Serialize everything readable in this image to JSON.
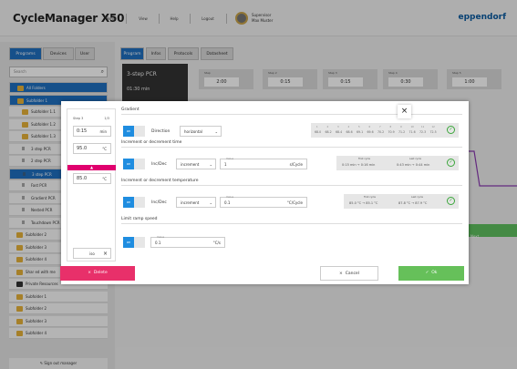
{
  "header": {
    "title": "CycleManager X50",
    "menu_items": [
      "Menu",
      "View",
      "Help",
      "Logout"
    ],
    "user_name": "Max Muster",
    "user_role": "Supervisor",
    "brand": "eppendorf"
  },
  "left": {
    "tabs": [
      "Programs",
      "Devices",
      "User"
    ],
    "search_placeholder": "Search",
    "tree": [
      {
        "label": "All Folders",
        "kind": "folder",
        "selected": true
      },
      {
        "label": "Subfolder 1",
        "kind": "folder",
        "selected": true
      },
      {
        "label": "Subfolder 1.1",
        "kind": "folder"
      },
      {
        "label": "Subfolder 1.2",
        "kind": "folder"
      },
      {
        "label": "Subfolder 1.3",
        "kind": "folder"
      },
      {
        "label": "3 step PCR",
        "kind": "program"
      },
      {
        "label": "2 step PCR",
        "kind": "program"
      },
      {
        "label": "3 step PCR",
        "kind": "program",
        "selected": true
      },
      {
        "label": "Fast PCR",
        "kind": "program"
      },
      {
        "label": "Gradient PCR",
        "kind": "program"
      },
      {
        "label": "Nested PCR",
        "kind": "program"
      },
      {
        "label": "Touchdown PCR",
        "kind": "program"
      },
      {
        "label": "Subfolder 2",
        "kind": "folder"
      },
      {
        "label": "Subfolder 3",
        "kind": "folder"
      },
      {
        "label": "Subfolder 4",
        "kind": "folder"
      },
      {
        "label": "Shar ed with me",
        "kind": "folder"
      },
      {
        "label": "Private Resources",
        "kind": "folder",
        "dark": true
      },
      {
        "label": "Subfolder 1",
        "kind": "folder"
      },
      {
        "label": "Subfolder 2",
        "kind": "folder"
      },
      {
        "label": "Subfolder 3",
        "kind": "folder"
      },
      {
        "label": "Subfolder 4",
        "kind": "folder"
      }
    ],
    "bottom_button": "Sign out manager"
  },
  "content": {
    "tabs": [
      "Program",
      "Infos",
      "Protocols",
      "Datasheet"
    ],
    "program_name": "3-step PCR",
    "program_time": "01:30 min",
    "steps": [
      {
        "label": "Step",
        "value": "2:00"
      },
      {
        "label": "Step 2",
        "value": "0:15"
      },
      {
        "label": "Step 3",
        "value": "0:15"
      },
      {
        "label": "Step 4",
        "value": "0:30"
      },
      {
        "label": "Step 5",
        "value": "1:00"
      }
    ],
    "next_button": "Next"
  },
  "modal": {
    "step_label": "Step 3",
    "step_count": "1/3",
    "time_value": "0:15",
    "time_unit": "min",
    "temp1_value": "95.0",
    "temp1_unit": "°C",
    "pink_arrow": "▲",
    "temp2_value": "85.0",
    "temp2_unit": "°C",
    "side_select": "iso",
    "sections": {
      "gradient": {
        "heading": "Gradient",
        "toggle_label": "on",
        "direction_label": "Direction",
        "direction_value": "horizontal",
        "values": [
          "68.0",
          "68.2",
          "68.4",
          "68.6",
          "69.1",
          "69.6",
          "70.2",
          "70.9",
          "71.2",
          "71.6",
          "72.3",
          "72.5"
        ],
        "indices": [
          "1",
          "2",
          "3",
          "4",
          "5",
          "6",
          "7",
          "8",
          "9",
          "10",
          "11",
          "12"
        ]
      },
      "inc_time": {
        "heading": "Increment or decrement time",
        "toggle_label": "on",
        "label": "Inc/Dec",
        "select_value": "increment",
        "input_title": "Value",
        "input_value": "1",
        "input_unit": "s/Cycle",
        "first_cycle_label": "First cycle",
        "first_cycle_value": "0:15 min → 0:16 min",
        "last_cycle_label": "Last cycle",
        "last_cycle_value": "0:43 min → 0:44 min"
      },
      "inc_temp": {
        "heading": "Increment or decrement temperature",
        "toggle_label": "on",
        "label": "Inc/Dec",
        "select_value": "increment",
        "input_title": "Value",
        "input_value": "0.1",
        "input_unit": "°C/Cycle",
        "first_cycle_label": "First cycle",
        "first_cycle_value": "85.0 °C → 85.1 °C",
        "last_cycle_label": "Last cycle",
        "last_cycle_value": "87.8 °C → 87.9 °C"
      },
      "ramp": {
        "heading": "Limit ramp speed",
        "toggle_label": "on",
        "input_title": "Value",
        "input_value": "0.1",
        "input_unit": "°C/s"
      }
    },
    "delete_label": "Delete",
    "cancel_label": "Cancel",
    "ok_label": "Ok"
  },
  "colors": {
    "primary": "#1f6fbf",
    "danger": "#e8306a",
    "success": "#66c05a",
    "gradient_pink": "#e0006e"
  }
}
